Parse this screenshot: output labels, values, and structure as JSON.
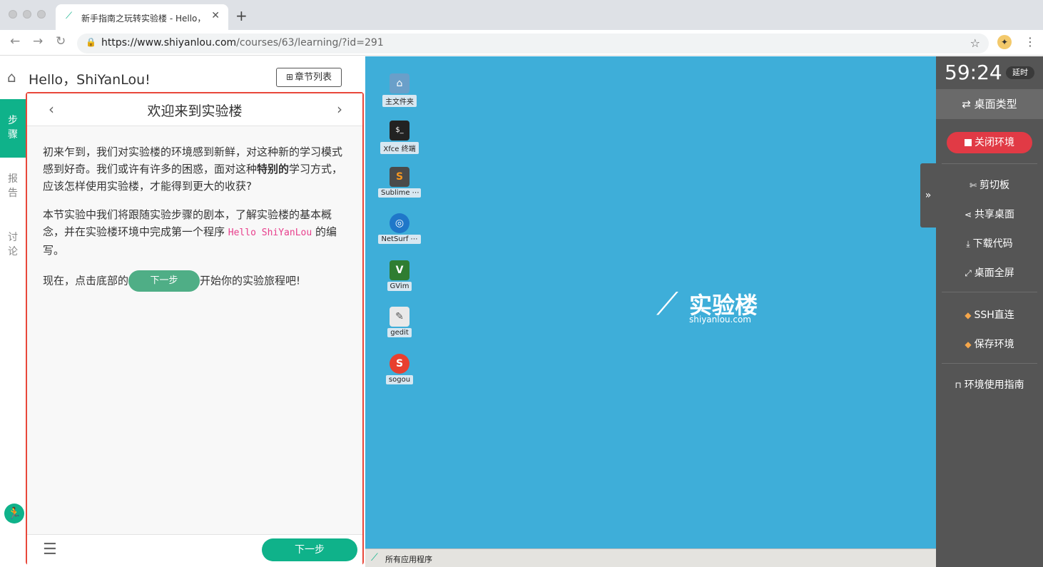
{
  "browser": {
    "tab_title": "新手指南之玩转实验楼 - Hello，",
    "tab_close": "✕",
    "new_tab": "+",
    "url_host": "https://www.shiyanlou.com",
    "url_path": "/courses/63/learning/?id=291"
  },
  "header": {
    "greeting": "Hello，ShiYanLou!",
    "chapter_list": "章节列表"
  },
  "side_tabs": [
    {
      "label": "步骤",
      "chars": [
        "步",
        "骤"
      ],
      "active": true
    },
    {
      "label": "报告",
      "chars": [
        "报",
        "告"
      ],
      "active": false
    },
    {
      "label": "讨论",
      "chars": [
        "讨",
        "论"
      ],
      "active": false
    }
  ],
  "lesson": {
    "title": "欢迎来到实验楼",
    "para1_a": "初来乍到，我们对实验楼的环境感到新鲜，对这种新的学习模式感到好奇。我们或许有许多的困惑，面对这种",
    "para1_bold": "特别的",
    "para1_b": "学习方式，应该怎样使用实验楼，才能得到更大的收获?",
    "para2_a": "本节实验中我们将跟随实验步骤的剧本，了解实验楼的基本概念，并在实验楼环境中完成第一个程序 ",
    "para2_code": "Hello ShiYanLou",
    "para2_b": " 的编写。",
    "para3_a": "现在，点击底部的",
    "para3_button": "下一步",
    "para3_b": "开始你的实验旅程吧!",
    "next_button": "下一步"
  },
  "desktop": {
    "icons": [
      {
        "label": "主文件夹",
        "icon": "folder-icon",
        "color": "#6a9fc9"
      },
      {
        "label": "Xfce 终端",
        "icon": "terminal-icon",
        "color": "#222222"
      },
      {
        "label": "Sublime ⋯",
        "icon": "sublime-icon",
        "color": "#4a4a4a"
      },
      {
        "label": "NetSurf ⋯",
        "icon": "globe-icon",
        "color": "#1f77c9"
      },
      {
        "label": "GVim",
        "icon": "vim-icon",
        "color": "#2f7d32"
      },
      {
        "label": "gedit",
        "icon": "text-editor-icon",
        "color": "#e9e9e9"
      },
      {
        "label": "sogou",
        "icon": "sogou-icon",
        "color": "#e8402f"
      }
    ],
    "logo_zh": "实验楼",
    "logo_en": "shiyanlou.com",
    "taskbar_label": "所有应用程序"
  },
  "right_panel": {
    "timer": "59:24",
    "delay": "延时",
    "desktop_type": "桌面类型",
    "close_env": "关闭环境",
    "clipboard": "剪切板",
    "share_desktop": "共享桌面",
    "download_code": "下载代码",
    "fullscreen": "桌面全屏",
    "ssh": "SSH直连",
    "save_env": "保存环境",
    "guide": "环境使用指南"
  }
}
